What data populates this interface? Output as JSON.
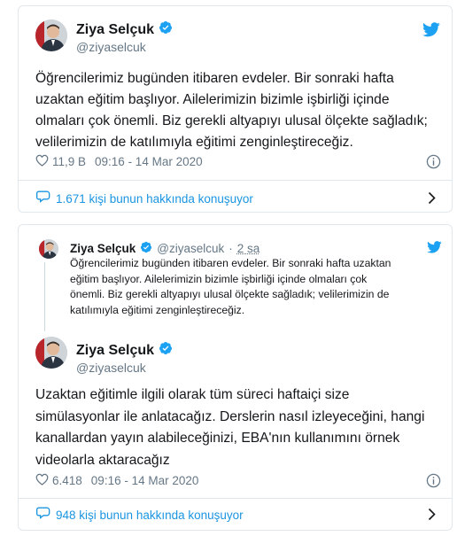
{
  "tweet1": {
    "author_name": "Ziya Selçuk",
    "author_handle": "@ziyaselcuk",
    "text_lines": [
      "Öğrencilerimiz bugünden itibaren evdeler. Bir sonraki hafta",
      "uzaktan eğitim başlıyor. Ailelerimizin bizimle işbirliği içinde",
      "olmaları çok önemli. Biz gerekli altyapıyı ulusal ölçekte sağladık;",
      "velilerimizin de katılımıyla eğitimi zenginleştireceğiz."
    ],
    "likes": "11,9 B",
    "time": "09:16 - 14 Mar 2020",
    "talking": "1.671 kişi bunun hakkında konuşuyor"
  },
  "tweet2": {
    "quoted": {
      "author_name": "Ziya Selçuk",
      "author_handle": "@ziyaselcuk",
      "separator": "·",
      "age": "2 sa",
      "text_lines": [
        "Öğrencilerimiz bugünden itibaren evdeler. Bir sonraki hafta uzaktan",
        "eğitim başlıyor. Ailelerimizin bizimle işbirliği içinde olmaları çok",
        "önemli. Biz gerekli altyapıyı ulusal ölçekte sağladık; velilerimizin de",
        "katılımıyla eğitimi zenginleştireceğiz."
      ]
    },
    "author_name": "Ziya Selçuk",
    "author_handle": "@ziyaselcuk",
    "text_lines": [
      "Uzaktan eğitimle ilgili olarak tüm süreci haftaiçi size",
      "simülasyonlar ile anlatacağız. Derslerin nasıl izleyeceğini, hangi",
      "kanallardan yayın alabileceğinizi, EBA'nın kullanımını örnek",
      "videolarla aktaracağız"
    ],
    "likes": "6.418",
    "time": "09:16 - 14 Mar 2020",
    "talking": "948 kişi bunun hakkında konuşuyor"
  },
  "colors": {
    "twitter_blue": "#1da1f2",
    "link_blue": "#1b95e0",
    "muted_gray": "#657786",
    "border": "#e1e8ed",
    "text": "#14171a"
  },
  "icons": {
    "bird": "twitter-bird-icon",
    "verified": "verified-badge-icon",
    "heart": "heart-icon",
    "info": "info-icon",
    "comment": "comment-bubble-icon",
    "chevron": "chevron-right-icon"
  }
}
